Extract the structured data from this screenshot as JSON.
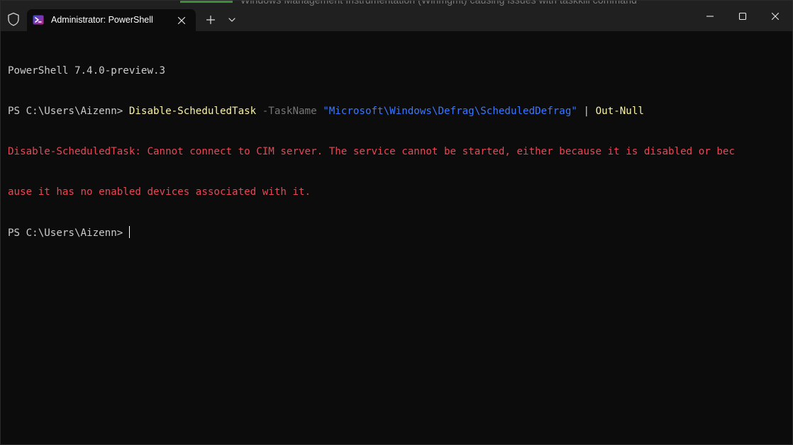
{
  "window": {
    "background_title": "Windows Management Instrumentation (Winmgmt) causing issues with taskkill command",
    "tab_title": "Administrator: PowerShell"
  },
  "icons": {
    "shield": "shield-icon",
    "tab": "powershell-icon",
    "tab_close": "close-icon",
    "new_tab": "plus-icon",
    "dropdown": "chevron-down-icon",
    "minimize": "minimize-icon",
    "maximize": "maximize-icon",
    "close": "close-icon"
  },
  "terminal": {
    "version_line": "PowerShell 7.4.0-preview.3",
    "prompt": "PS C:\\Users\\Aizenn> ",
    "command": {
      "cmdlet": "Disable-ScheduledTask",
      "param_name": "-TaskName",
      "param_value": "\"Microsoft\\Windows\\Defrag\\ScheduledDefrag\"",
      "pipe": "|",
      "pipe_cmdlet": "Out-Null"
    },
    "error_line_1": "Disable-ScheduledTask: Cannot connect to CIM server. The service cannot be started, either because it is disabled or bec",
    "error_line_2": "ause it has no enabled devices associated with it.",
    "final_prompt": "PS C:\\Users\\Aizenn> "
  },
  "colors": {
    "background": "#0c0c0c",
    "titlebar": "#202020",
    "foreground": "#cccccc",
    "cmdlet": "#f9f1a5",
    "parameter": "#767676",
    "string": "#3b78ff",
    "error": "#e74856"
  }
}
